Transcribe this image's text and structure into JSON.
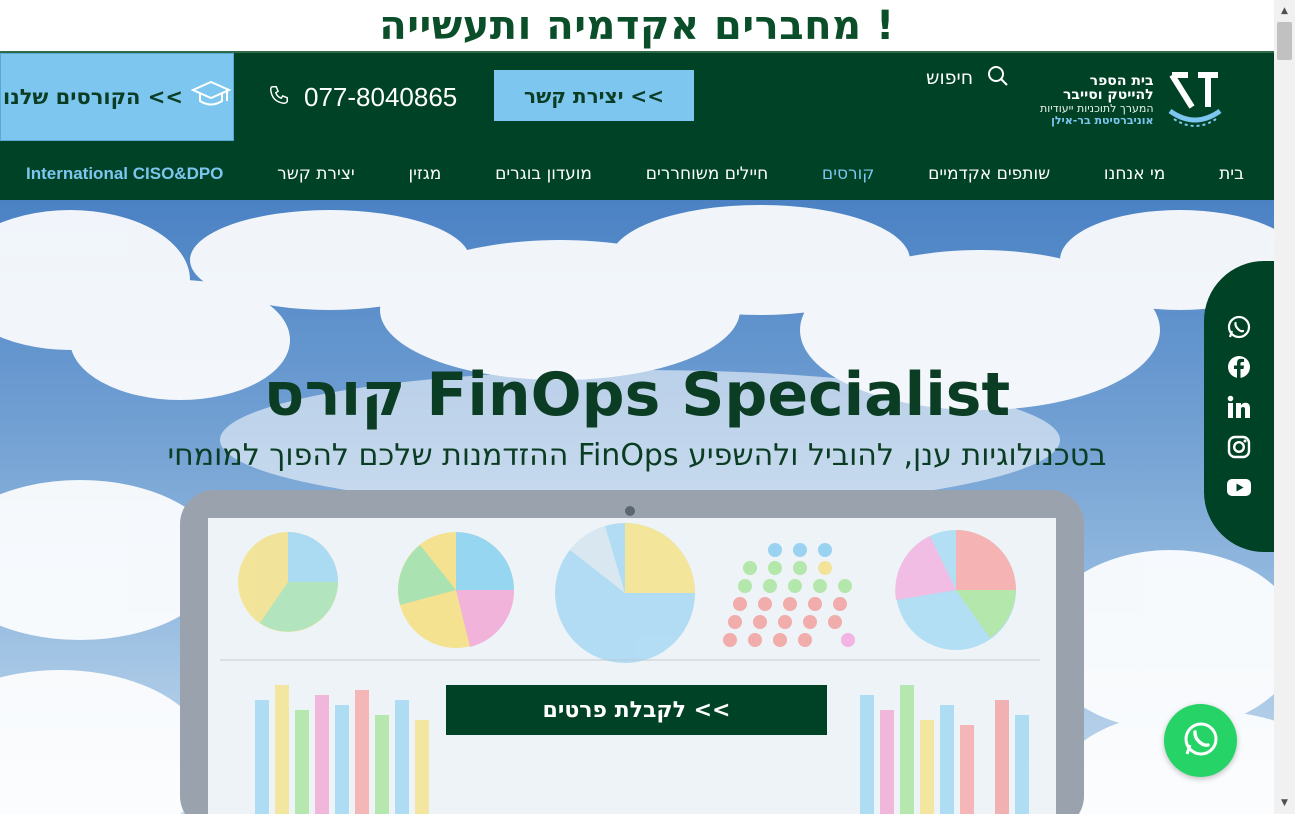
{
  "banner": {
    "text": "מחברים אקדמיה ותעשייה !"
  },
  "header": {
    "courses_button": "הקורסים שלנו <<",
    "phone": "077-8040865",
    "contact_button": "יצירת קשר <<",
    "search_label": "חיפוש",
    "logo": {
      "line1": "בית הספר",
      "line2": "להייטק וסייבר",
      "line3": "המערך לתוכניות ייעודיות",
      "line4": "אוניברסיטת בר-אילן"
    }
  },
  "nav": {
    "items": [
      {
        "label": "בית"
      },
      {
        "label": "מי אנחנו"
      },
      {
        "label": "שותפים אקדמיים"
      },
      {
        "label": "קורסים"
      },
      {
        "label": "חיילים משוחררים"
      },
      {
        "label": "מועדון בוגרים"
      },
      {
        "label": "מגזין"
      },
      {
        "label": "יצירת קשר"
      },
      {
        "label": "International CISO&DPO"
      }
    ]
  },
  "hero": {
    "title": "קורס FinOps Specialist",
    "subtitle": "ההזדמנות שלכם להפוך למומחי FinOps בטכנולוגיות ענן, להוביל ולהשפיע",
    "cta": "לקבלת פרטים <<"
  },
  "social": {
    "icons": [
      "whatsapp-icon",
      "facebook-icon",
      "linkedin-icon",
      "instagram-icon",
      "youtube-icon"
    ]
  },
  "colors": {
    "dark_green": "#004225",
    "light_blue": "#7cc6ef",
    "whatsapp_green": "#25d366"
  }
}
